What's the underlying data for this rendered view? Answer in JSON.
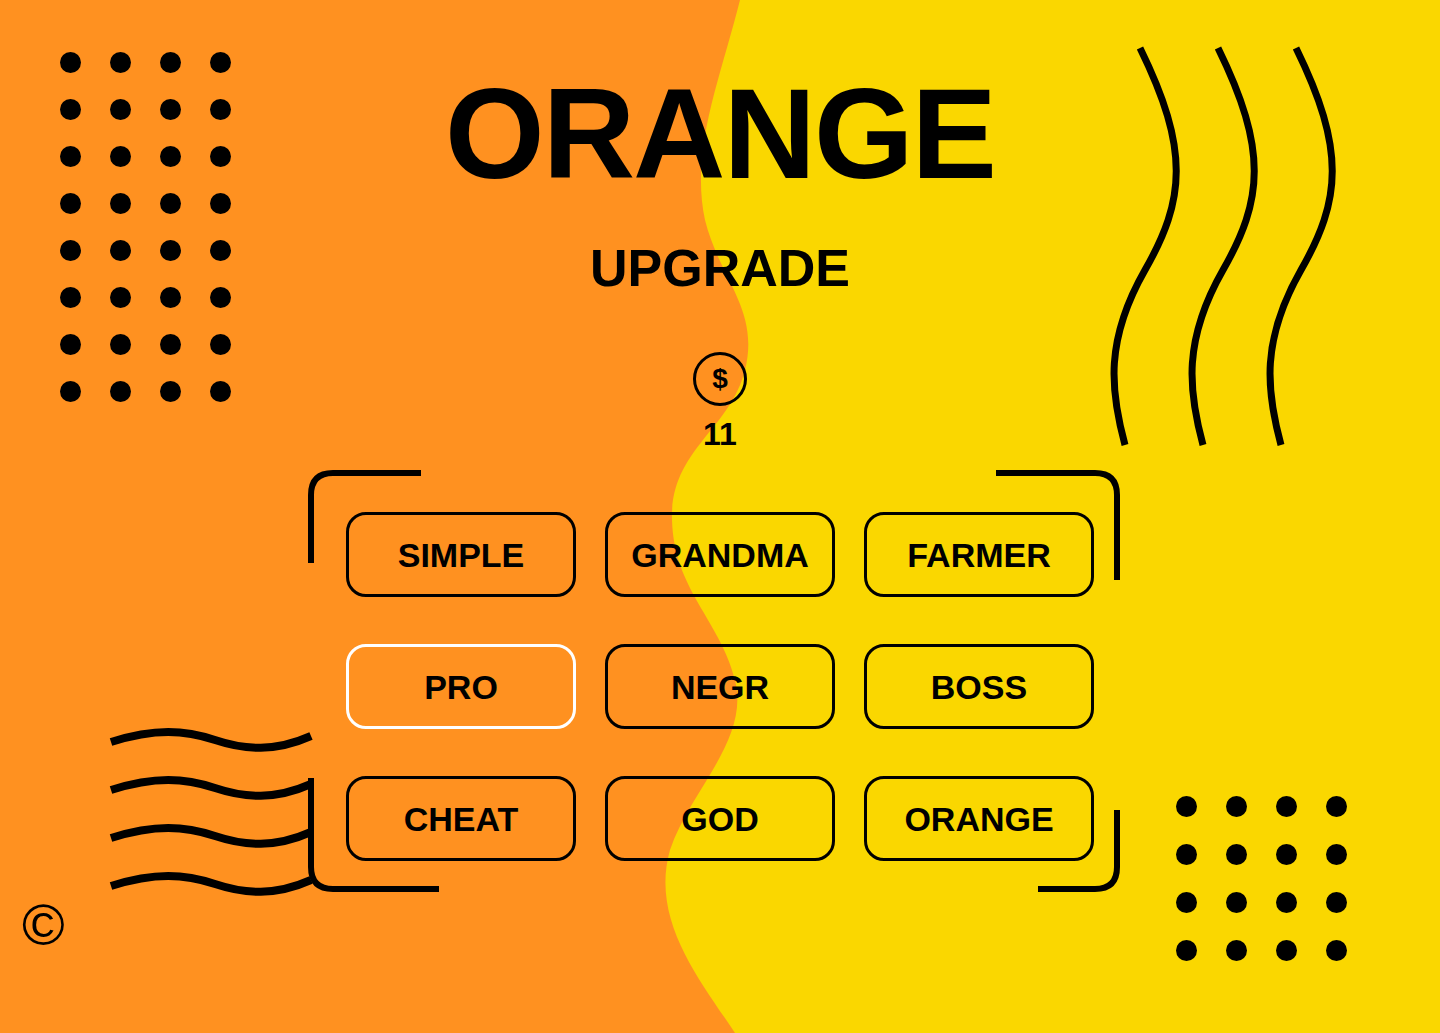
{
  "header": {
    "title": "ORANGE",
    "subtitle": "UPGRADE"
  },
  "wallet": {
    "coin_symbol": "$",
    "amount": "11"
  },
  "upgrades": [
    {
      "label": "SIMPLE",
      "selected": false
    },
    {
      "label": "GRANDMA",
      "selected": false
    },
    {
      "label": "FARMER",
      "selected": false
    },
    {
      "label": "PRO",
      "selected": true
    },
    {
      "label": "NEGR",
      "selected": false
    },
    {
      "label": "BOSS",
      "selected": false
    },
    {
      "label": "CHEAT",
      "selected": false
    },
    {
      "label": "GOD",
      "selected": false
    },
    {
      "label": "ORANGE",
      "selected": false
    }
  ],
  "footer": {
    "copyright": "©"
  }
}
